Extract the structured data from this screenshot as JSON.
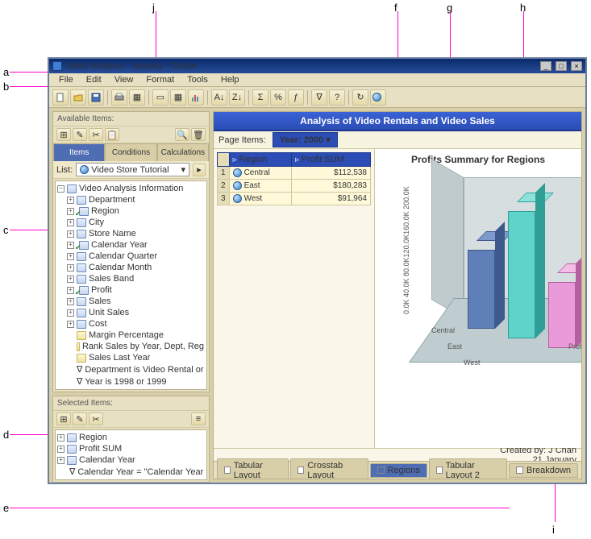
{
  "callouts": {
    "a": "a",
    "b": "b",
    "c": "c",
    "d": "d",
    "e": "e",
    "f": "f",
    "g": "g",
    "h": "h",
    "i": "i",
    "j": "j"
  },
  "window": {
    "title": "Sales Analysis - January - Oracle"
  },
  "menu": {
    "file": "File",
    "edit": "Edit",
    "view": "View",
    "format": "Format",
    "tools": "Tools",
    "help": "Help"
  },
  "left": {
    "available_label": "Available Items:",
    "tabs": {
      "items": "Items",
      "conditions": "Conditions",
      "calculations": "Calculations"
    },
    "list_label": "List:",
    "list_value": "Video Store Tutorial",
    "tree_root": "Video Analysis Information",
    "tree_items": [
      {
        "label": "Department",
        "checked": false
      },
      {
        "label": "Region",
        "checked": true
      },
      {
        "label": "City",
        "checked": false
      },
      {
        "label": "Store Name",
        "checked": false
      },
      {
        "label": "Calendar Year",
        "checked": true
      },
      {
        "label": "Calendar Quarter",
        "checked": false
      },
      {
        "label": "Calendar Month",
        "checked": false
      },
      {
        "label": "Sales Band",
        "checked": false
      },
      {
        "label": "Profit",
        "checked": true
      },
      {
        "label": "Sales",
        "checked": false
      },
      {
        "label": "Unit Sales",
        "checked": false
      },
      {
        "label": "Cost",
        "checked": false
      }
    ],
    "tree_fns": [
      "Margin Percentage",
      "Rank Sales by Year, Dept, Reg",
      "Sales Last Year",
      "Department is Video Rental or",
      "Year is 1998 or 1999"
    ],
    "selected_label": "Selected Items:",
    "selected": [
      {
        "label": "Region"
      },
      {
        "label": "Profit SUM"
      },
      {
        "label": "Calendar Year"
      }
    ],
    "selected_cond": "Calendar Year = \"Calendar Year Parame"
  },
  "banner": "Analysis of Video Rentals and Video Sales",
  "pageitems": {
    "label": "Page Items:",
    "year_label": "Year:",
    "year_value": "2000"
  },
  "table": {
    "cols": {
      "region": "Region",
      "profit": "Profit SUM"
    },
    "rows": [
      {
        "idx": "1",
        "region": "Central",
        "profit": "$112,538"
      },
      {
        "idx": "2",
        "region": "East",
        "profit": "$180,283"
      },
      {
        "idx": "3",
        "region": "West",
        "profit": "$91,964"
      }
    ]
  },
  "chart": {
    "title": "Profits Summary for Regions",
    "yaxis": "0.0K 40.0K 80.0K120.0K160.0K 200.0K",
    "xcats": {
      "c1": "Central",
      "c2": "East",
      "c3": "West"
    },
    "series": "Profit SUM"
  },
  "chart_data": {
    "type": "bar",
    "title": "Profits Summary for Regions",
    "categories": [
      "Central",
      "East",
      "West"
    ],
    "values": [
      112538,
      180283,
      91964
    ],
    "ylabel": "",
    "ylim": [
      0,
      200000
    ],
    "series_name": "Profit SUM"
  },
  "footer": {
    "created": "Created by: J Chan",
    "date": "21 January"
  },
  "worktabs": {
    "t1": "Tabular Layout",
    "t2": "Crosstab Layout",
    "t3": "Regions",
    "t4": "Tabular Layout 2",
    "t5": "Breakdown"
  }
}
